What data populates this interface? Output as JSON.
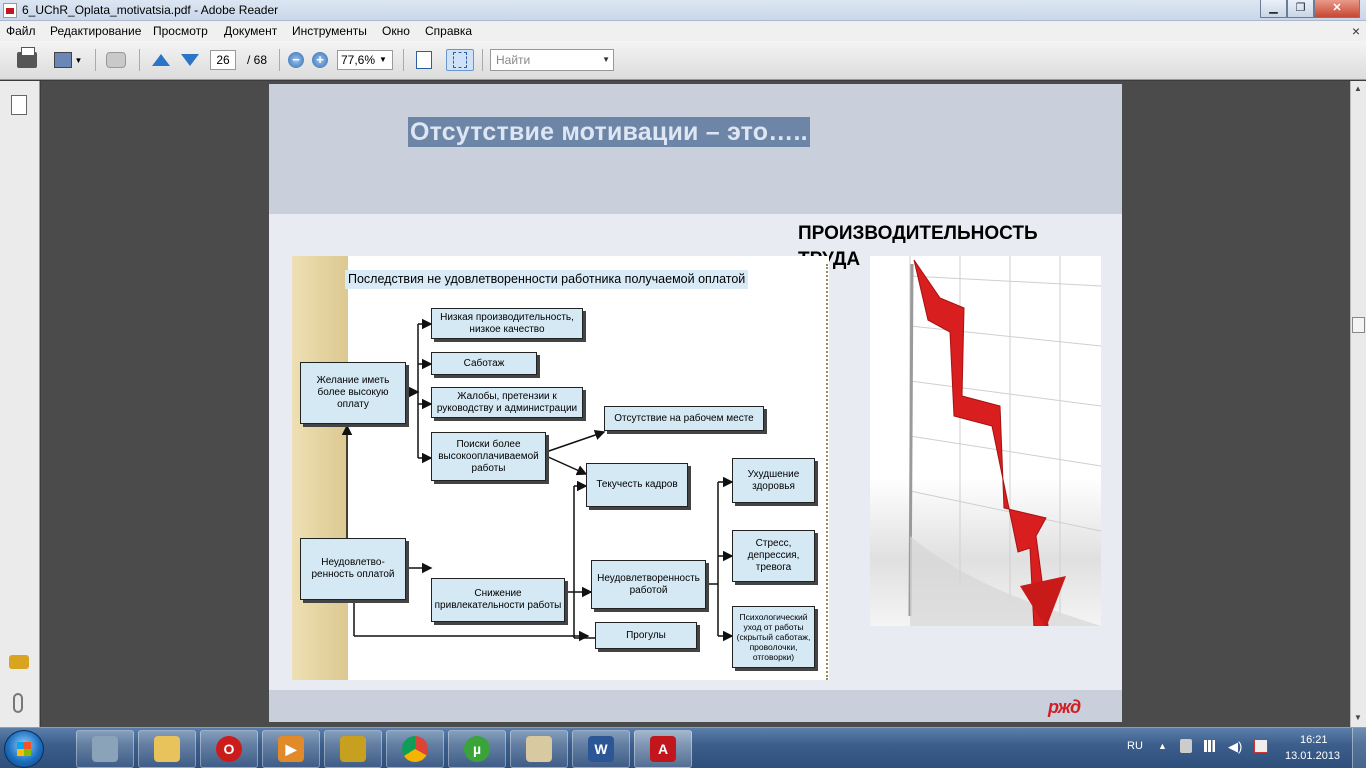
{
  "window": {
    "title": "6_UChR_Oplata_motivatsia.pdf - Adobe Reader",
    "controls": {
      "minimize": "▁",
      "maximize": "❐",
      "close": "✕"
    }
  },
  "menu": [
    "Файл",
    "Редактирование",
    "Просмотр",
    "Документ",
    "Инструменты",
    "Окно",
    "Справка"
  ],
  "toolbar": {
    "page_current": "26",
    "page_total": "/ 68",
    "zoom": "77,6%",
    "search_placeholder": "Найти"
  },
  "slide": {
    "title": "Отсутствие мотивации – это…..",
    "side_label_line1": "ПРОИЗВОДИТЕЛЬНОСТЬ",
    "side_label_line2": "ТРУДА",
    "logo": "ржд",
    "diagram": {
      "title": "Последствия не удовлетворенности работника получаемой оплатой",
      "boxes": {
        "desire": "Желание иметь более высокую оплату",
        "dissatisfaction": "Неудовлетво-ренность оплатой",
        "low_productivity": "Низкая производительность, низкое качество",
        "sabotage": "Саботаж",
        "complaints": "Жалобы, претензии к руководству и администрации",
        "job_search": "Поиски более высокооплачиваемой работы",
        "absence": "Отсутствие на рабочем месте",
        "turnover": "Текучесть кадров",
        "attractiveness": "Снижение привлекательности работы",
        "job_dissatisfaction": "Неудовлетворенность работой",
        "absenteeism": "Прогулы",
        "health": "Ухудшение здоровья",
        "stress": "Стресс, депрессия, тревога",
        "withdrawal": "Психологический уход от работы (скрытый саботаж, проволочки, отговорки)"
      }
    }
  },
  "taskbar": {
    "language": "RU",
    "time": "16:21",
    "date": "13.01.2013"
  }
}
